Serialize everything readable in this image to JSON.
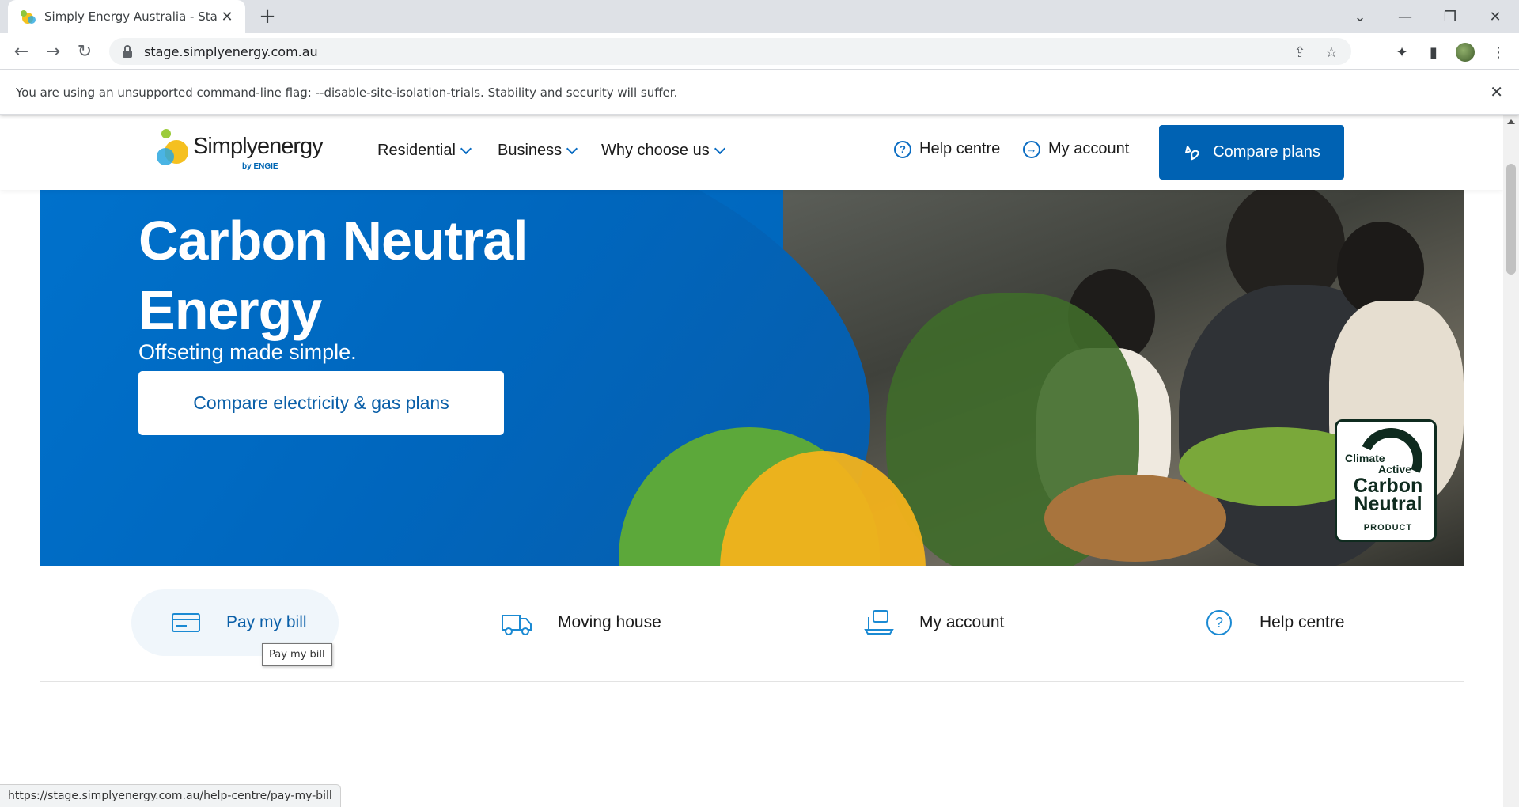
{
  "browser": {
    "tab_title": "Simply Energy Australia - Start To",
    "new_tab_symbol": "+",
    "url": "stage.simplyenergy.com.au",
    "infobar_text": "You are using an unsupported command-line flag: --disable-site-isolation-trials. Stability and security will suffer.",
    "status_url": "https://stage.simplyenergy.com.au/help-centre/pay-my-bill"
  },
  "site": {
    "logo_text": "Simplyenergy",
    "logo_sub": "by ENGIE",
    "nav": [
      {
        "label": "Residential"
      },
      {
        "label": "Business"
      },
      {
        "label": "Why choose us"
      }
    ],
    "help_label": "Help centre",
    "account_label": "My account",
    "compare_label": "Compare plans"
  },
  "hero": {
    "title": "Carbon Neutral Energy",
    "subtitle": "Offseting made simple.",
    "cta": "Compare electricity & gas plans",
    "badge": {
      "line1": "Climate",
      "line2": "Active",
      "line3": "Carbon Neutral",
      "line4": "PRODUCT"
    }
  },
  "quick_links": [
    {
      "label": "Pay my bill",
      "icon": "card-icon"
    },
    {
      "label": "Moving house",
      "icon": "truck-icon"
    },
    {
      "label": "My account",
      "icon": "laptop-icon"
    },
    {
      "label": "Help centre",
      "icon": "question-icon"
    }
  ],
  "tooltip": "Pay my bill",
  "colors": {
    "brand_blue": "#0062b3",
    "hero_blue": "#0072cc",
    "accent_green": "#5ca83a",
    "accent_yellow": "#f2b21b"
  }
}
